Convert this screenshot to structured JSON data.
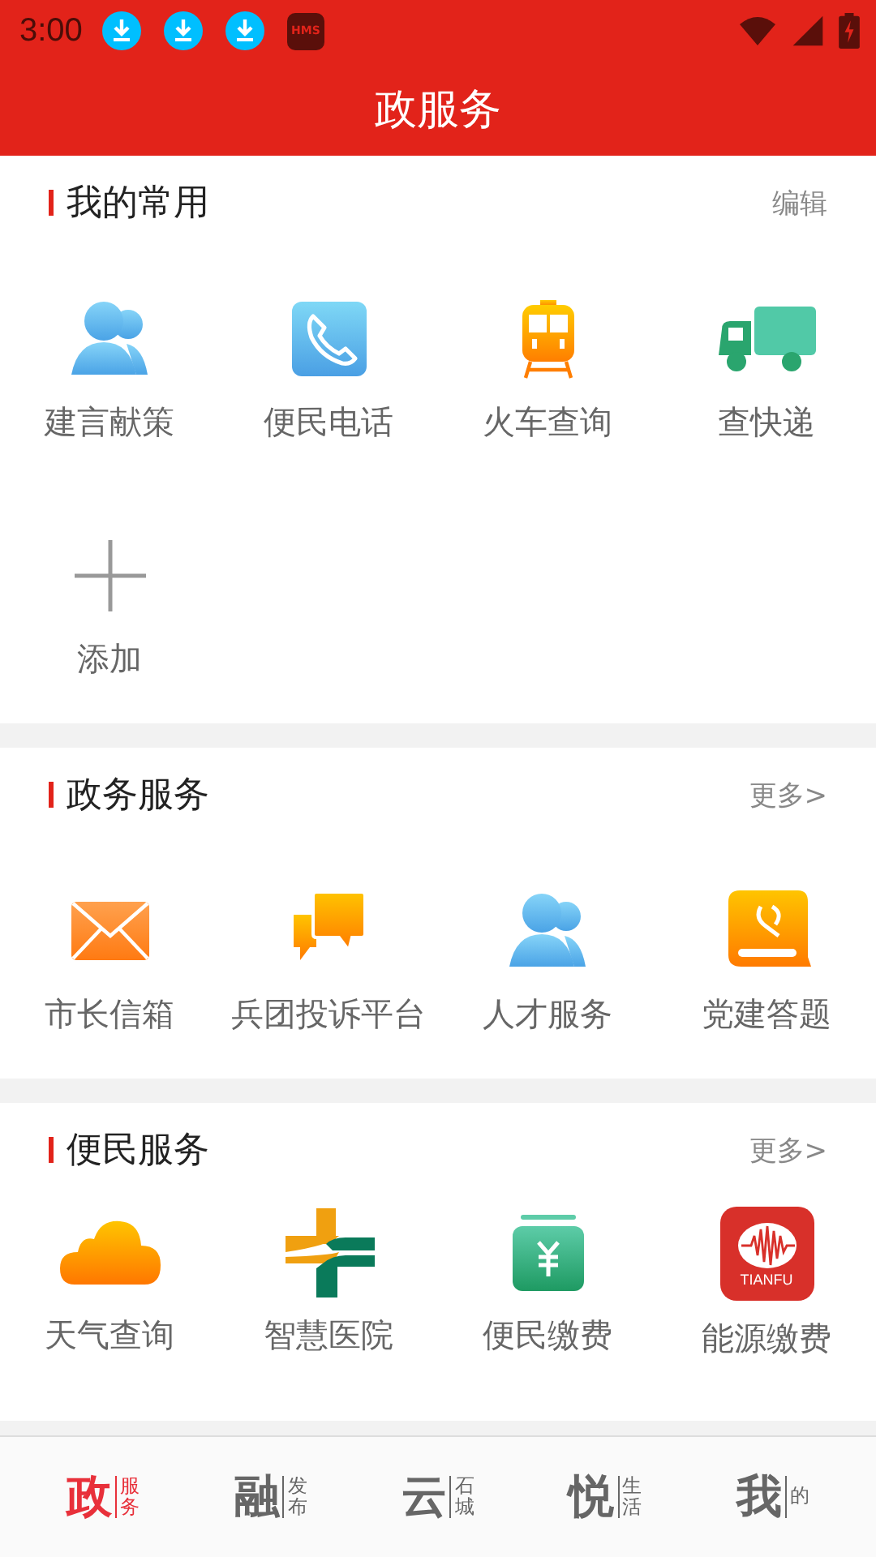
{
  "status_bar": {
    "time": "3:00",
    "notifications": [
      {
        "kind": "download"
      },
      {
        "kind": "download"
      },
      {
        "kind": "download"
      },
      {
        "kind": "hms",
        "text": "HMS"
      }
    ]
  },
  "header": {
    "title": "政服务"
  },
  "sections": [
    {
      "title": "我的常用",
      "action": "编辑",
      "items": [
        {
          "label": "建言献策",
          "kind": "people"
        },
        {
          "label": "便民电话",
          "kind": "phone"
        },
        {
          "label": "火车查询",
          "kind": "train"
        },
        {
          "label": "查快递",
          "kind": "truck"
        },
        {
          "label": "添加",
          "kind": "add"
        }
      ]
    },
    {
      "title": "政务服务",
      "action": "更多>",
      "items": [
        {
          "label": "市长信箱",
          "kind": "mail"
        },
        {
          "label": "兵团投诉平台",
          "kind": "chat"
        },
        {
          "label": "人才服务",
          "kind": "people"
        },
        {
          "label": "党建答题",
          "kind": "book"
        }
      ]
    },
    {
      "title": "便民服务",
      "action": "更多>",
      "items": [
        {
          "label": "天气查询",
          "kind": "cloud"
        },
        {
          "label": "智慧医院",
          "kind": "cross"
        },
        {
          "label": "便民缴费",
          "kind": "payment"
        },
        {
          "label": "能源缴费",
          "kind": "logo",
          "logo_text": "TIANFU"
        }
      ]
    }
  ],
  "bottom_nav": [
    {
      "main": "政",
      "sub": "服务",
      "selected": true
    },
    {
      "main": "融",
      "sub": "发布",
      "selected": false
    },
    {
      "main": "云",
      "sub": "石城",
      "selected": false
    },
    {
      "main": "悦",
      "sub": "生活",
      "selected": false
    },
    {
      "main": "我",
      "sub": "的",
      "selected": false
    }
  ]
}
